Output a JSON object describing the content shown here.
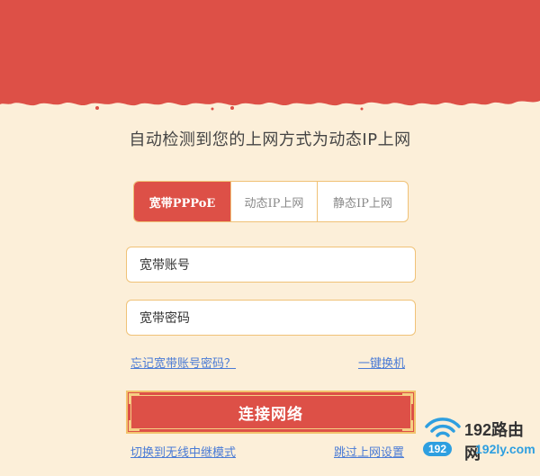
{
  "banner": {
    "color": "#dd5047"
  },
  "headline": "自动检测到您的上网方式为动态IP上网",
  "tabs": [
    {
      "label": "宽带PPPoE",
      "active": true
    },
    {
      "label": "动态IP上网",
      "active": false
    },
    {
      "label": "静态IP上网",
      "active": false
    }
  ],
  "form": {
    "account_placeholder": "宽带账号",
    "password_placeholder": "宽带密码"
  },
  "links": {
    "forgot": "忘记宽带账号密码？",
    "one_key": "一键换机",
    "switch_mode": "切换到无线中继模式",
    "skip": "跳过上网设置"
  },
  "connect_button": "连接网络",
  "watermark": {
    "brand": "192路由网",
    "pill": "192",
    "domain": "192ly.com"
  },
  "colors": {
    "accent": "#dd5047",
    "background": "#fcefd9",
    "border": "#f0c277",
    "link": "#4a7bd6"
  }
}
